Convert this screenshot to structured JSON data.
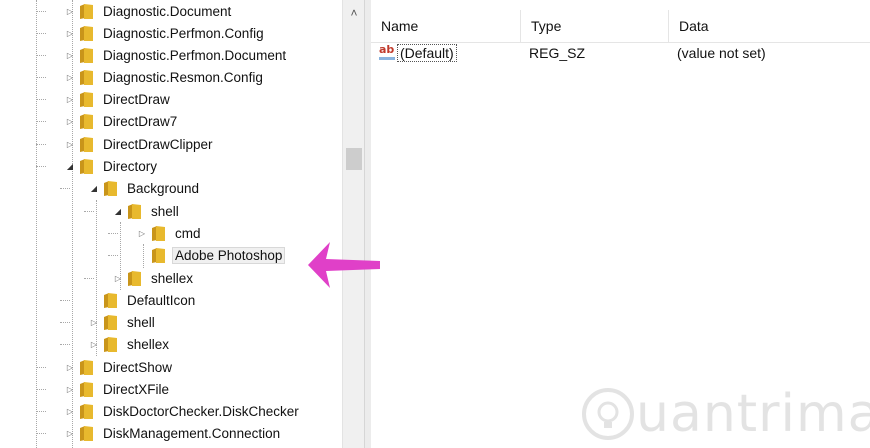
{
  "tree": {
    "items": [
      {
        "label": "Diagnostic.Document",
        "expander": "collapsed"
      },
      {
        "label": "Diagnostic.Perfmon.Config",
        "expander": "collapsed"
      },
      {
        "label": "Diagnostic.Perfmon.Document",
        "expander": "collapsed"
      },
      {
        "label": "Diagnostic.Resmon.Config",
        "expander": "collapsed"
      },
      {
        "label": "DirectDraw",
        "expander": "collapsed"
      },
      {
        "label": "DirectDraw7",
        "expander": "collapsed"
      },
      {
        "label": "DirectDrawClipper",
        "expander": "collapsed"
      },
      {
        "label": "Directory",
        "expander": "expanded"
      },
      {
        "label": "Background",
        "expander": "expanded"
      },
      {
        "label": "shell",
        "expander": "expanded"
      },
      {
        "label": "cmd",
        "expander": "collapsed"
      },
      {
        "label": "Adobe Photoshop",
        "expander": "none",
        "selected": true
      },
      {
        "label": "shellex",
        "expander": "collapsed"
      },
      {
        "label": "DefaultIcon",
        "expander": "none"
      },
      {
        "label": "shell",
        "expander": "collapsed"
      },
      {
        "label": "shellex",
        "expander": "collapsed"
      },
      {
        "label": "DirectShow",
        "expander": "collapsed"
      },
      {
        "label": "DirectXFile",
        "expander": "collapsed"
      },
      {
        "label": "DiskDoctorChecker.DiskChecker",
        "expander": "collapsed"
      },
      {
        "label": "DiskManagement.Connection",
        "expander": "collapsed"
      }
    ]
  },
  "values": {
    "columns": {
      "name": "Name",
      "type": "Type",
      "data": "Data"
    },
    "rows": [
      {
        "icon": "string-value-icon",
        "icon_text": "ab",
        "name": "(Default)",
        "type": "REG_SZ",
        "data": "(value not set)"
      }
    ]
  },
  "icons": {
    "folder": "folder-icon",
    "scroll_up": "chevron-up-icon",
    "annotation": "arrow-left-icon"
  },
  "colors": {
    "folder": "#e8b92e",
    "annotation_arrow": "#e040c8",
    "selection": "#f0f0f0"
  },
  "watermark": {
    "text": "uantrimang"
  }
}
